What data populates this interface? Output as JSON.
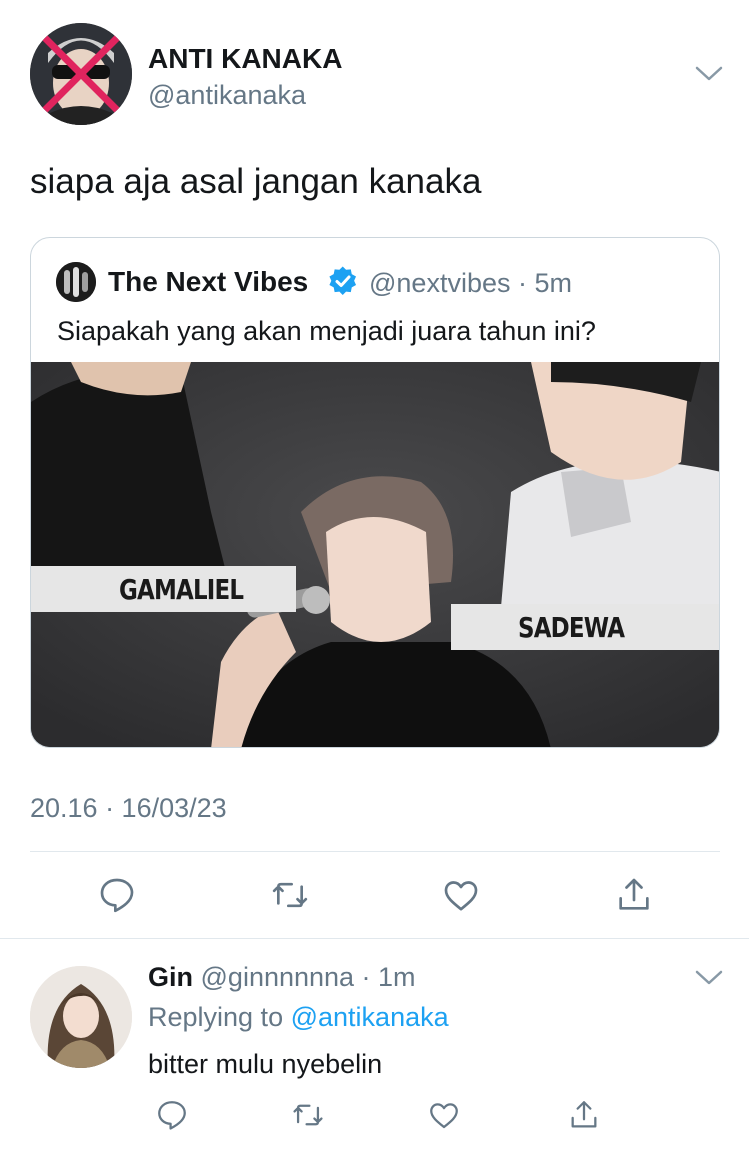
{
  "tweet": {
    "author_name": "ANTI KANAKA",
    "author_handle": "@antikanaka",
    "text": "siapa aja asal jangan kanaka",
    "timestamp": "20.16 · 16/03/23",
    "avatar_icon": "crossed-out-avatar"
  },
  "quote": {
    "author_name": "The Next Vibes",
    "author_handle": "@nextvibes · 5m",
    "verified_icon": "verified-badge-icon",
    "text": "Siapakah yang akan menjadi juara tahun ini?",
    "image_labels": {
      "left": "GAMALIEL",
      "right": "SADEWA"
    }
  },
  "actions": {
    "reply_icon": "reply-icon",
    "retweet_icon": "retweet-icon",
    "like_icon": "heart-icon",
    "share_icon": "share-icon"
  },
  "reply": {
    "author_name": "Gin",
    "author_handle": "@ginnnnnna · 1m",
    "replying_prefix": "Replying to",
    "replying_to": "@antikanaka",
    "text": "bitter mulu nyebelin"
  },
  "colors": {
    "text": "#14171a",
    "secondary": "#657786",
    "link": "#1da1f2",
    "verified": "#1da1f2",
    "divider": "#e1e8ed"
  }
}
